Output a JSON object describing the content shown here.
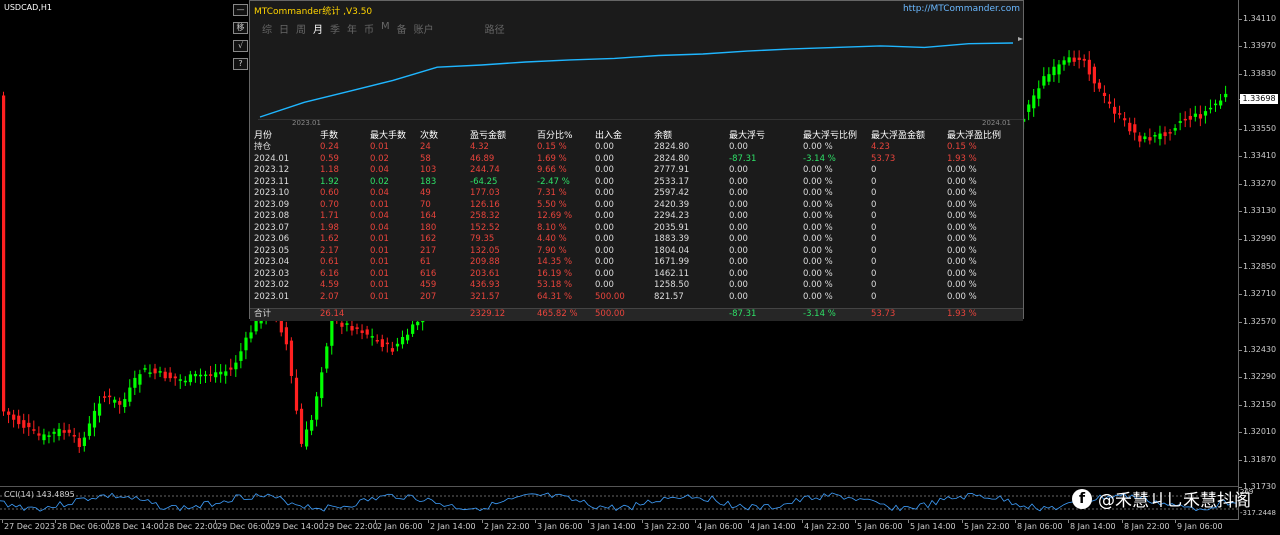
{
  "symbol": "USDCAD,H1",
  "side_buttons": [
    "—",
    "移",
    "√",
    "?"
  ],
  "panel": {
    "title": "MTCommander统计 ,V3.50",
    "url": "http://MTCommander.com",
    "tabs": [
      {
        "label": "综",
        "active": false
      },
      {
        "label": "日",
        "active": false
      },
      {
        "label": "周",
        "active": false
      },
      {
        "label": "月",
        "active": true
      },
      {
        "label": "季",
        "active": false
      },
      {
        "label": "年",
        "active": false
      },
      {
        "label": "币",
        "active": false
      },
      {
        "label": "M",
        "active": false
      },
      {
        "label": "备",
        "active": false
      },
      {
        "label": "账户",
        "active": false
      }
    ],
    "path_tab": "路径",
    "equity_start_label": "2023.01",
    "equity_end_label": "2024.01",
    "equity_values": [
      0,
      20,
      35,
      50,
      68,
      71,
      75,
      78,
      80,
      84,
      86,
      90,
      93,
      95,
      97,
      95,
      100,
      101
    ],
    "headers": [
      "月份",
      "手数",
      "最大手数",
      "次数",
      "盈亏金额",
      "百分比%",
      "出入金",
      "余额",
      "最大浮亏",
      "最大浮亏比例",
      "最大浮盈金额",
      "最大浮盈比例"
    ],
    "rows": [
      [
        "持仓",
        "0.24",
        "0.01",
        "24",
        "4.32",
        "0.15 %",
        "0.00",
        "2824.80",
        "0.00",
        "0.00 %",
        "4.23",
        "0.15 %"
      ],
      [
        "2024.01",
        "0.59",
        "0.02",
        "58",
        "46.89",
        "1.69 %",
        "0.00",
        "2824.80",
        "-87.31",
        "-3.14 %",
        "53.73",
        "1.93 %"
      ],
      [
        "2023.12",
        "1.18",
        "0.04",
        "103",
        "244.74",
        "9.66 %",
        "0.00",
        "2777.91",
        "0.00",
        "0.00 %",
        "0",
        "0.00 %"
      ],
      [
        "2023.11",
        "1.92",
        "0.02",
        "183",
        "-64.25",
        "-2.47 %",
        "0.00",
        "2533.17",
        "0.00",
        "0.00 %",
        "0",
        "0.00 %"
      ],
      [
        "2023.10",
        "0.60",
        "0.04",
        "49",
        "177.03",
        "7.31 %",
        "0.00",
        "2597.42",
        "0.00",
        "0.00 %",
        "0",
        "0.00 %"
      ],
      [
        "2023.09",
        "0.70",
        "0.01",
        "70",
        "126.16",
        "5.50 %",
        "0.00",
        "2420.39",
        "0.00",
        "0.00 %",
        "0",
        "0.00 %"
      ],
      [
        "2023.08",
        "1.71",
        "0.04",
        "164",
        "258.32",
        "12.69 %",
        "0.00",
        "2294.23",
        "0.00",
        "0.00 %",
        "0",
        "0.00 %"
      ],
      [
        "2023.07",
        "1.98",
        "0.04",
        "180",
        "152.52",
        "8.10 %",
        "0.00",
        "2035.91",
        "0.00",
        "0.00 %",
        "0",
        "0.00 %"
      ],
      [
        "2023.06",
        "1.62",
        "0.01",
        "162",
        "79.35",
        "4.40 %",
        "0.00",
        "1883.39",
        "0.00",
        "0.00 %",
        "0",
        "0.00 %"
      ],
      [
        "2023.05",
        "2.17",
        "0.01",
        "217",
        "132.05",
        "7.90 %",
        "0.00",
        "1804.04",
        "0.00",
        "0.00 %",
        "0",
        "0.00 %"
      ],
      [
        "2023.04",
        "0.61",
        "0.01",
        "61",
        "209.88",
        "14.35 %",
        "0.00",
        "1671.99",
        "0.00",
        "0.00 %",
        "0",
        "0.00 %"
      ],
      [
        "2023.03",
        "6.16",
        "0.01",
        "616",
        "203.61",
        "16.19 %",
        "0.00",
        "1462.11",
        "0.00",
        "0.00 %",
        "0",
        "0.00 %"
      ],
      [
        "2023.02",
        "4.59",
        "0.01",
        "459",
        "436.93",
        "53.18 %",
        "0.00",
        "1258.50",
        "0.00",
        "0.00 %",
        "0",
        "0.00 %"
      ],
      [
        "2023.01",
        "2.07",
        "0.01",
        "207",
        "321.57",
        "64.31 %",
        "500.00",
        "821.57",
        "0.00",
        "0.00 %",
        "0",
        "0.00 %"
      ]
    ],
    "total": [
      "合计",
      "26.14",
      "",
      "",
      "2329.12",
      "465.82 %",
      "500.00",
      "",
      "-87.31",
      "-3.14 %",
      "53.73",
      "1.93 %"
    ]
  },
  "price_axis": {
    "labels": [
      "1.34110",
      "1.33970",
      "1.33830",
      "1.33698",
      "1.33550",
      "1.33410",
      "1.33270",
      "1.33130",
      "1.32990",
      "1.32850",
      "1.32710",
      "1.32570",
      "1.32430",
      "1.32290",
      "1.32150",
      "1.32010",
      "1.31870",
      "1.31730"
    ],
    "current": "1.33698"
  },
  "cci": {
    "label": "CCI(14) 143.4895",
    "top_value": "269",
    "bottom_value": "-317.2448"
  },
  "time_axis": [
    "27 Dec 2023",
    "28 Dec 06:00",
    "28 Dec 14:00",
    "28 Dec 22:00",
    "29 Dec 06:00",
    "29 Dec 14:00",
    "29 Dec 22:00",
    "2 Jan 06:00",
    "2 Jan 14:00",
    "2 Jan 22:00",
    "3 Jan 06:00",
    "3 Jan 14:00",
    "3 Jan 22:00",
    "4 Jan 06:00",
    "4 Jan 14:00",
    "4 Jan 22:00",
    "5 Jan 06:00",
    "5 Jan 14:00",
    "5 Jan 22:00",
    "8 Jan 06:00",
    "8 Jan 14:00",
    "8 Jan 22:00",
    "9 Jan 06:00"
  ],
  "watermark": "@禾慧ㄐ乚禾慧抖阁",
  "colors": {
    "bull": "#00ff00",
    "bear": "#ff2020",
    "equity_line": "#1fb6ff",
    "panel_bg": "#1b1b1b"
  }
}
